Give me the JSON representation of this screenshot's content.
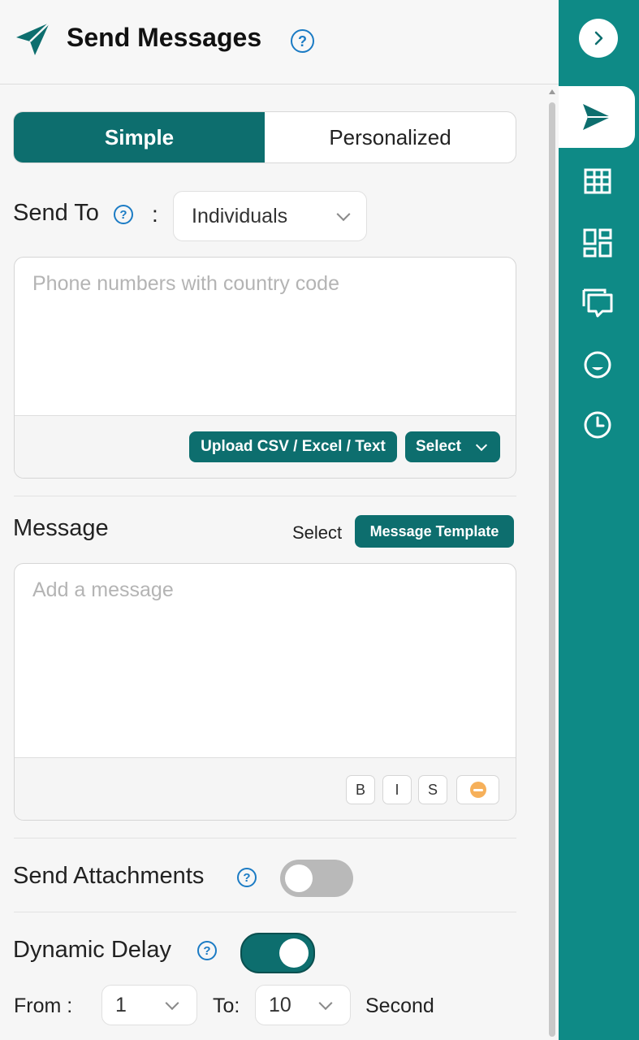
{
  "header": {
    "title": "Send Messages",
    "help": "?"
  },
  "mode_tabs": [
    {
      "label": "Simple",
      "active": true
    },
    {
      "label": "Personalized",
      "active": false
    }
  ],
  "send_to": {
    "label": "Send To",
    "help": "?",
    "colon": ":",
    "selected": "Individuals",
    "phone_placeholder": "Phone numbers with country code",
    "upload_label": "Upload CSV / Excel / Text",
    "select_label": "Select"
  },
  "message": {
    "label": "Message",
    "select_text": "Select",
    "template_label": "Message Template",
    "placeholder": "Add a message",
    "format": {
      "bold": "B",
      "italic": "I",
      "strike": "S"
    }
  },
  "attachments": {
    "label": "Send Attachments",
    "help": "?",
    "enabled": false
  },
  "delay": {
    "label": "Dynamic Delay",
    "help": "?",
    "enabled": true,
    "from_label": "From :",
    "from_value": "1",
    "to_label": "To:",
    "to_value": "10",
    "unit": "Second"
  },
  "sidebar": {
    "icons": [
      "chevron-right-icon",
      "send-icon",
      "table-icon",
      "dashboard-icon",
      "chat-icon",
      "smile-icon",
      "clock-icon"
    ]
  },
  "colors": {
    "primary": "#0d6e6e",
    "sidebar": "#0e8a86",
    "help": "#1b7bc4"
  }
}
